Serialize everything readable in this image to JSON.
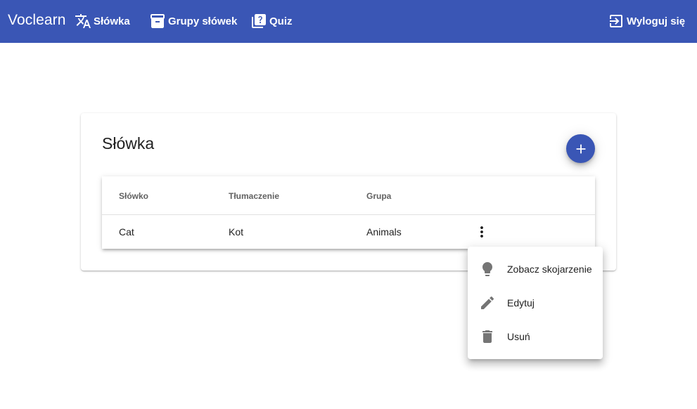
{
  "appbar": {
    "brand": "Voclearn",
    "nav": [
      {
        "label": "Słówka",
        "icon": "translate-icon"
      },
      {
        "label": "Grupy słówek",
        "icon": "archive-icon"
      },
      {
        "label": "Quiz",
        "icon": "quiz-icon"
      }
    ],
    "logout": {
      "label": "Wyloguj się",
      "icon": "logout-icon"
    }
  },
  "card": {
    "title": "Słówka",
    "add_button_icon": "plus-icon"
  },
  "table": {
    "columns": [
      "Słówko",
      "Tłumaczenie",
      "Grupa"
    ],
    "rows": [
      {
        "word": "Cat",
        "translation": "Kot",
        "group": "Animals"
      }
    ]
  },
  "row_menu": {
    "items": [
      {
        "label": "Zobacz skojarzenie",
        "icon": "lightbulb-icon"
      },
      {
        "label": "Edytuj",
        "icon": "pencil-icon"
      },
      {
        "label": "Usuń",
        "icon": "trash-icon"
      }
    ]
  },
  "colors": {
    "primary": "#3a56b5",
    "icon_grey": "#757575"
  }
}
